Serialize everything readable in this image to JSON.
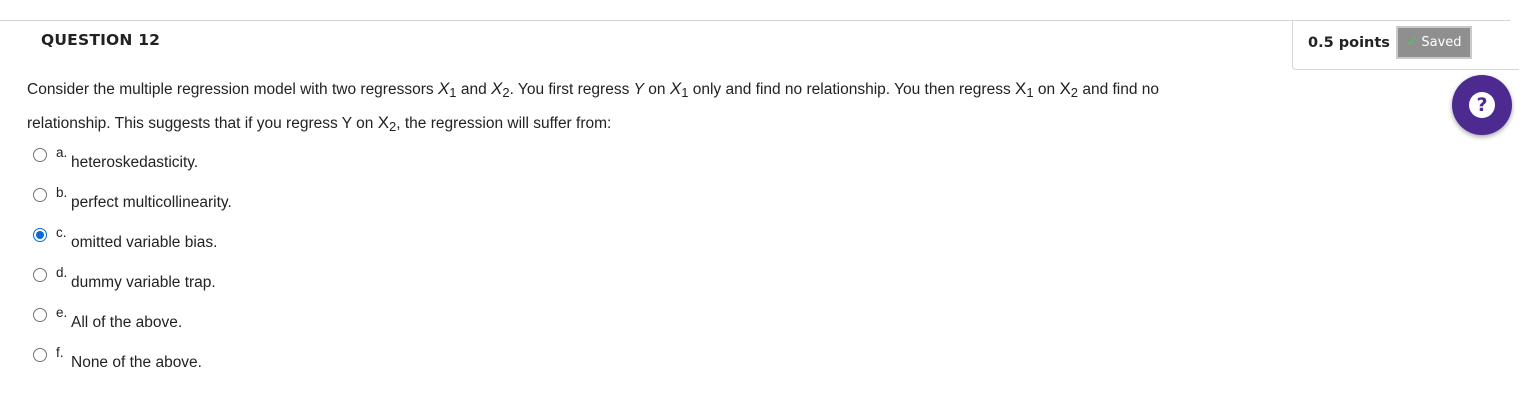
{
  "question": {
    "title": "QUESTION 12",
    "points": "0.5 points",
    "status": "Saved",
    "text": {
      "p1": "Consider the multiple regression model with two regressors ",
      "x": "X",
      "sub1": "1",
      "and": " and ",
      "sub2": "2",
      "p2": ". You first regress ",
      "y": "Y",
      "on": " on ",
      "p3": " only and find no relationship. You then regress ",
      "p4": " and find no relationship. This suggests that if you regress Y on ",
      "p5": ", the regression will suffer from:"
    },
    "options": [
      {
        "letter": "a.",
        "label": "heteroskedasticity.",
        "selected": false
      },
      {
        "letter": "b.",
        "label": "perfect multicollinearity.",
        "selected": false
      },
      {
        "letter": "c.",
        "label": "omitted variable bias.",
        "selected": true
      },
      {
        "letter": "d.",
        "label": "dummy variable trap.",
        "selected": false
      },
      {
        "letter": "e.",
        "label": "All of the above.",
        "selected": false
      },
      {
        "letter": "f.",
        "label": "None of the above.",
        "selected": false
      }
    ]
  },
  "icons": {
    "saved": "check-icon",
    "help": "question-mark-icon"
  },
  "colors": {
    "help_button": "#4d2a8f",
    "saved_badge": "#8f8f8f",
    "radio_selected": "#0b6bd6"
  }
}
